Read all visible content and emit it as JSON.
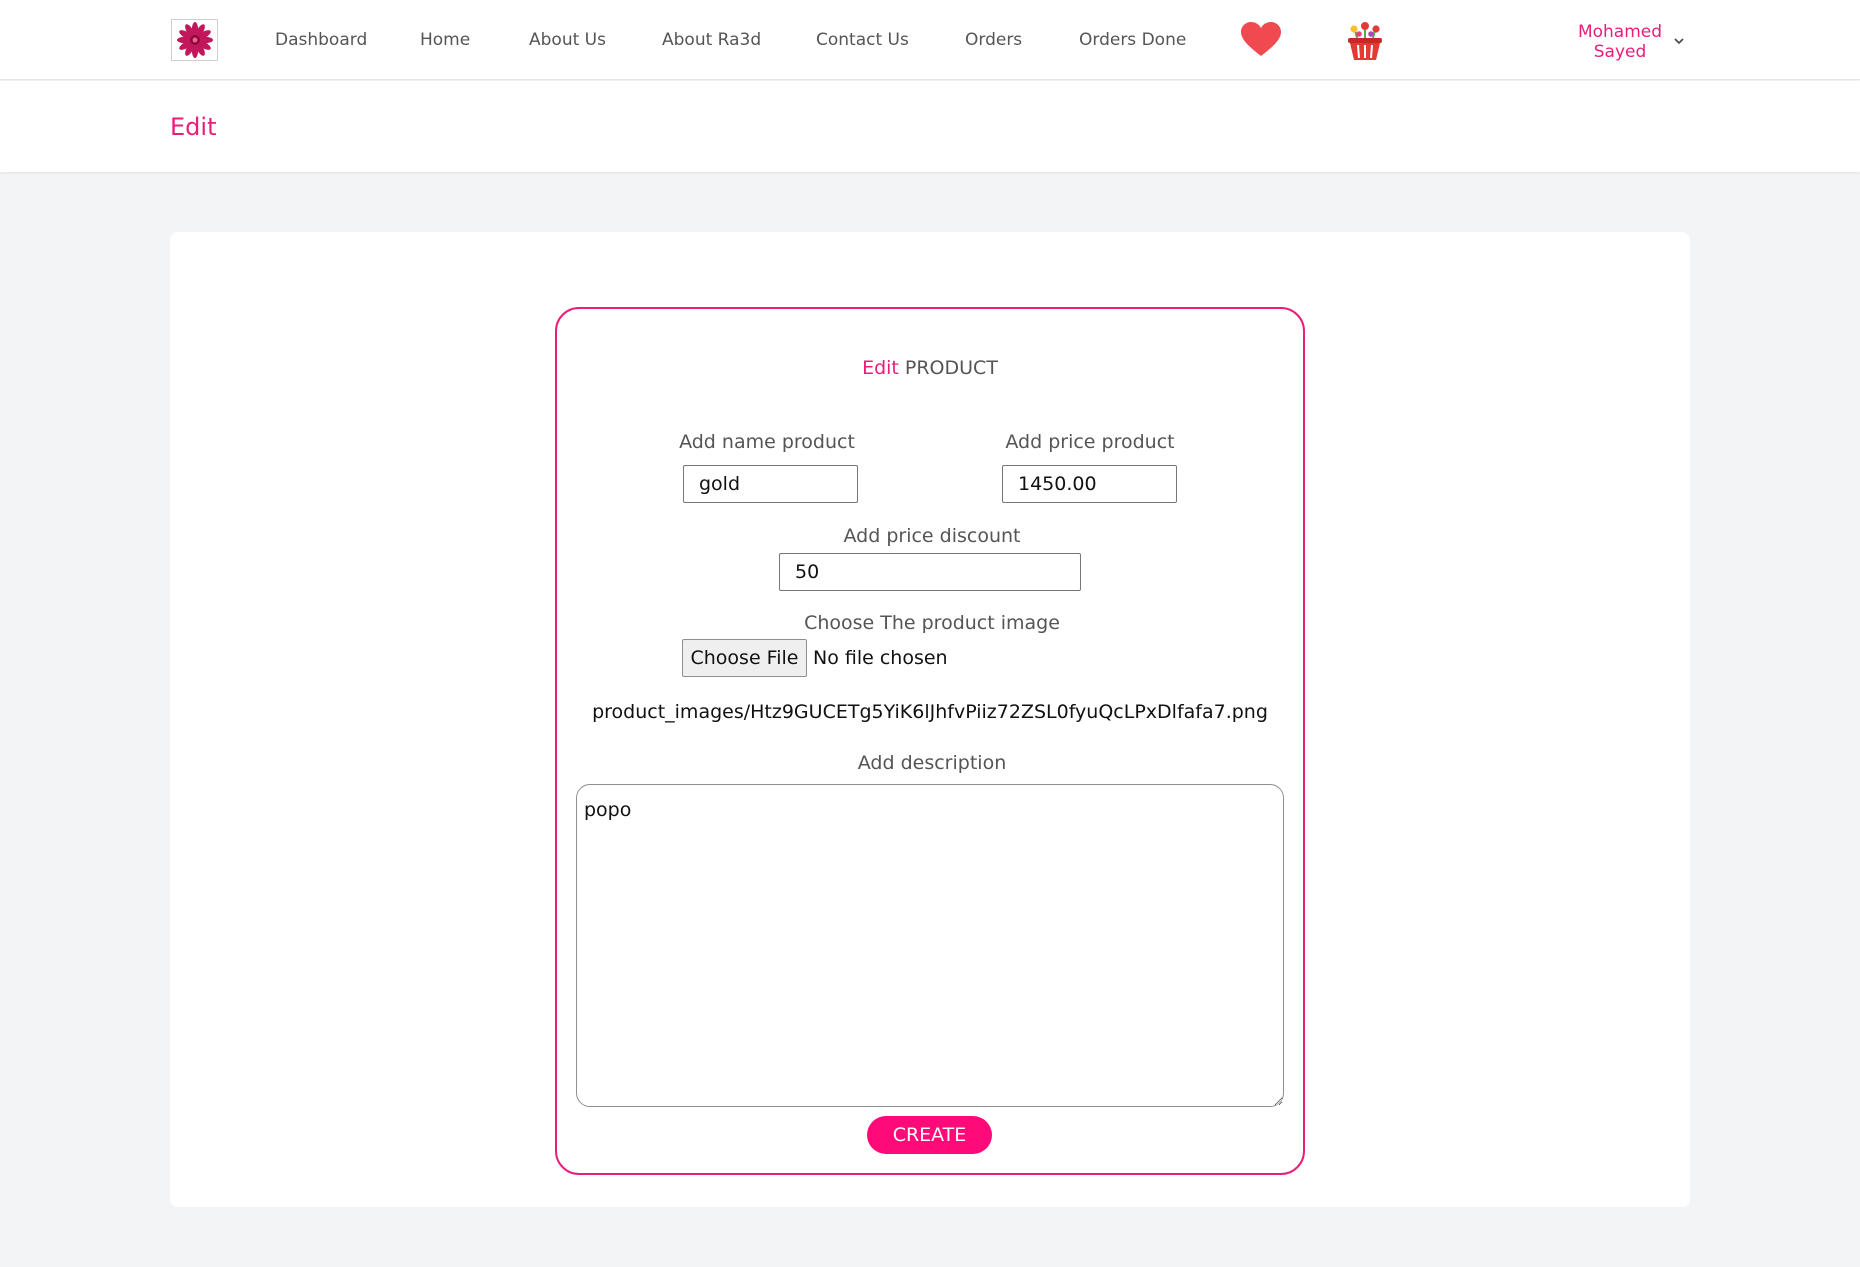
{
  "nav": {
    "links": [
      "Dashboard",
      "Home",
      "About Us",
      "About Ra3d",
      "Contact Us",
      "Orders",
      "Orders Done"
    ],
    "user": {
      "first": "Mohamed",
      "last": "Sayed"
    },
    "accent_color": "#e91e7a",
    "icons": [
      "flower-logo-icon",
      "heart-icon",
      "flower-basket-icon",
      "chevron-down-icon"
    ]
  },
  "header": {
    "title": "Edit"
  },
  "form": {
    "title_accent": "Edit",
    "title_rest": " PRODUCT",
    "name_label": "Add name product",
    "name_value": "gold",
    "price_label": "Add price product",
    "price_value": "1450.00",
    "discount_label": "Add price discount",
    "discount_value": "50",
    "image_label": "Choose The product image",
    "file_button": "Choose File",
    "file_status": "No file chosen",
    "current_image": "product_images/Htz9GUCETg5YiK6lJhfvPiiz72ZSL0fyuQcLPxDlfafa7.png",
    "description_label": "Add description",
    "description_value": "popo",
    "submit_label": "CREATE",
    "submit_color": "#ff0a78"
  }
}
